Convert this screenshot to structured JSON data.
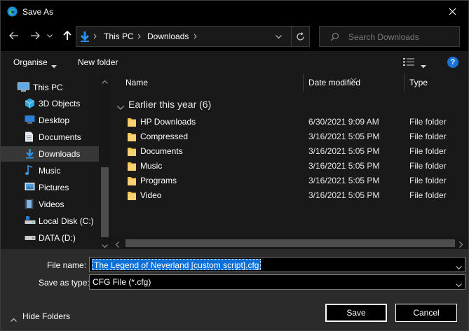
{
  "window": {
    "title": "Save As"
  },
  "address": {
    "crumbs": [
      "This PC",
      "Downloads"
    ]
  },
  "search": {
    "placeholder": "Search Downloads"
  },
  "toolbar": {
    "organise_label": "Organise",
    "new_folder_label": "New folder",
    "help_label": "?"
  },
  "sidebar": {
    "items": [
      {
        "label": "This PC",
        "icon": "monitor-icon",
        "selected": false
      },
      {
        "label": "3D Objects",
        "icon": "cube-icon",
        "selected": false
      },
      {
        "label": "Desktop",
        "icon": "desktop-icon",
        "selected": false
      },
      {
        "label": "Documents",
        "icon": "document-icon",
        "selected": false
      },
      {
        "label": "Downloads",
        "icon": "download-arrow-icon",
        "selected": true
      },
      {
        "label": "Music",
        "icon": "music-note-icon",
        "selected": false
      },
      {
        "label": "Pictures",
        "icon": "picture-icon",
        "selected": false
      },
      {
        "label": "Videos",
        "icon": "film-icon",
        "selected": false
      },
      {
        "label": "Local Disk (C:)",
        "icon": "drive-icon",
        "selected": false
      },
      {
        "label": "DATA (D:)",
        "icon": "drive-icon",
        "selected": false
      }
    ]
  },
  "columns": {
    "name": "Name",
    "date": "Date modified",
    "type": "Type"
  },
  "group": {
    "label": "Earlier this year (6)"
  },
  "files": [
    {
      "name": "HP Downloads",
      "date": "6/30/2021 9:09 AM",
      "type": "File folder"
    },
    {
      "name": "Compressed",
      "date": "3/16/2021 5:05 PM",
      "type": "File folder"
    },
    {
      "name": "Documents",
      "date": "3/16/2021 5:05 PM",
      "type": "File folder"
    },
    {
      "name": "Music",
      "date": "3/16/2021 5:05 PM",
      "type": "File folder"
    },
    {
      "name": "Programs",
      "date": "3/16/2021 5:05 PM",
      "type": "File folder"
    },
    {
      "name": "Video",
      "date": "3/16/2021 5:05 PM",
      "type": "File folder"
    }
  ],
  "form": {
    "filename_label": "File name:",
    "filename_value": "The Legend of Neverland [custom script].cfg",
    "savetype_label": "Save as type:",
    "savetype_value": "CFG File (*.cfg)"
  },
  "footer": {
    "hide_folders_label": "Hide Folders",
    "save_label": "Save",
    "cancel_label": "Cancel"
  },
  "colors": {
    "accent": "#0a6fd8",
    "folder": "#f5c54a",
    "background": "#191919"
  }
}
